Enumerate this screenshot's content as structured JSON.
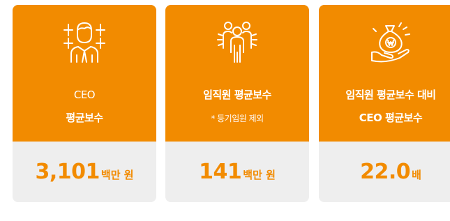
{
  "cards": [
    {
      "icon": "ceo-person-icon",
      "title_line1": "CEO",
      "title_line2": "평균보수",
      "note": "",
      "value": "3,101",
      "unit": "백만 원"
    },
    {
      "icon": "employees-group-icon",
      "title_line1": "임직원 평균보수",
      "title_line2": "",
      "note": "* 등기임원 제외",
      "value": "141",
      "unit": "백만 원"
    },
    {
      "icon": "money-bag-hand-icon",
      "title_line1": "임직원 평균보수 대비",
      "title_line2": "CEO 평균보수",
      "note": "",
      "value": "22.0",
      "unit": "배"
    }
  ],
  "colors": {
    "accent": "#f28b00",
    "card_bottom_bg": "#eeeeee",
    "text_on_accent": "#ffffff"
  }
}
